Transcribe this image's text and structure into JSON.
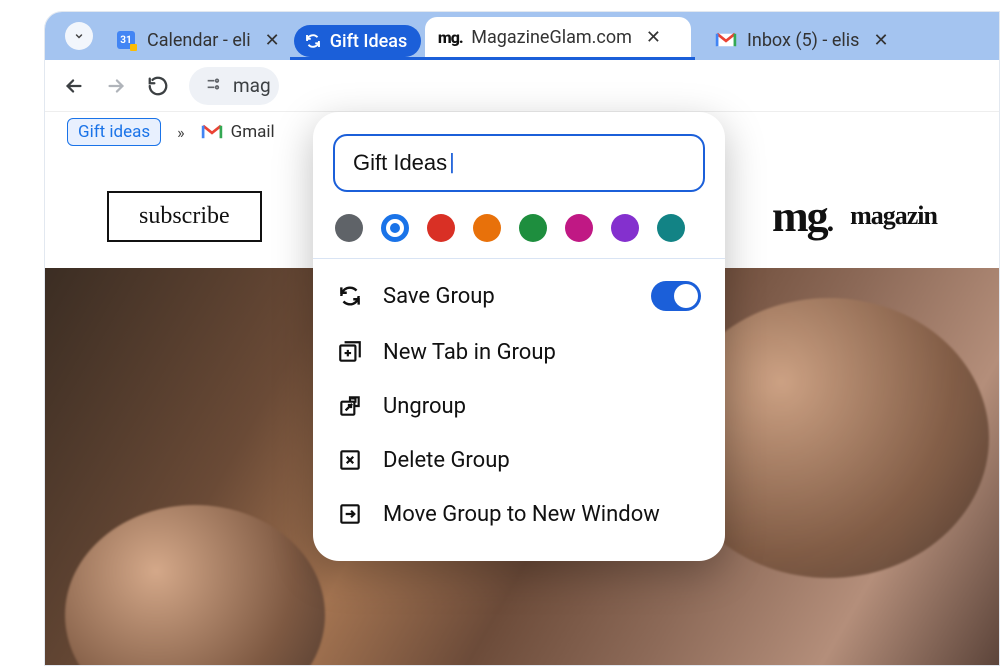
{
  "tabs": {
    "calendar": {
      "title": "Calendar - eli",
      "icon_day": "31"
    },
    "group_chip": {
      "label": "Gift Ideas"
    },
    "magazine": {
      "title": "MagazineGlam.com",
      "favicon": "mg"
    },
    "inbox": {
      "title": "Inbox (5) - elis"
    }
  },
  "toolbar": {
    "omnibox_text": "mag"
  },
  "bookmarks": {
    "chip": "Gift ideas",
    "gmail": "Gmail"
  },
  "page": {
    "subscribe": "subscribe",
    "brand_logo": "mg",
    "brand_text": "magazin"
  },
  "tab_group_panel": {
    "name_value": "Gift Ideas",
    "colors": [
      "#5f6368",
      "selected-blue",
      "#d93025",
      "#e8710a",
      "#188038",
      "#c5221f_magenta",
      "#9334e6",
      "#1e8e8e"
    ],
    "color_values": [
      "#5f6368",
      "#1a73e8",
      "#d93025",
      "#e8710a",
      "#1e8e3e",
      "#c01884",
      "#8430ce",
      "#128385"
    ],
    "items": {
      "save_group": "Save Group",
      "new_tab": "New Tab in Group",
      "ungroup": "Ungroup",
      "delete": "Delete Group",
      "move": "Move Group to New Window"
    },
    "save_toggle_on": true
  }
}
